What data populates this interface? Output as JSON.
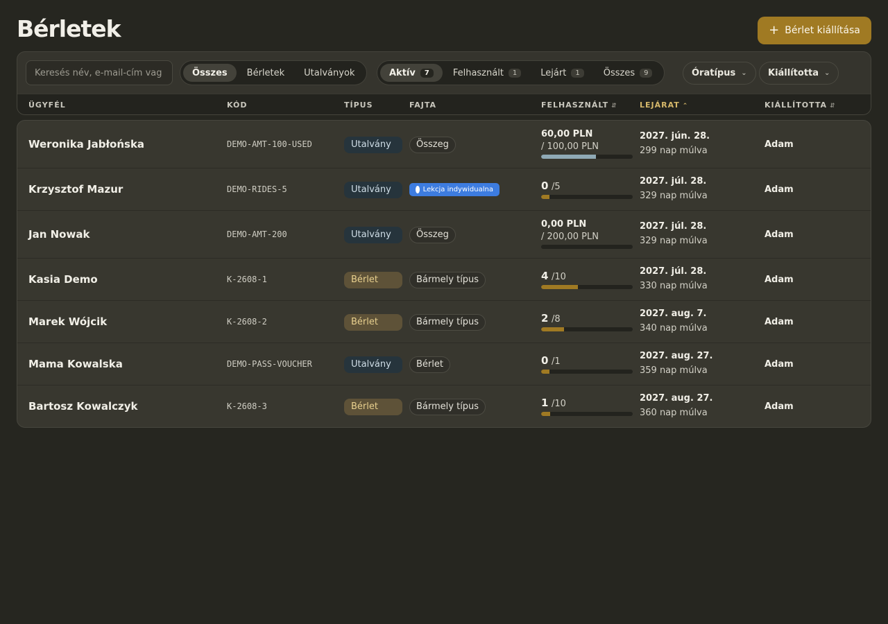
{
  "page": {
    "title": "Bérletek"
  },
  "actions": {
    "issue_label": "Bérlet kiállítása"
  },
  "search": {
    "placeholder": "Keresés név, e-mail-cím vag"
  },
  "type_filter": [
    "Összes",
    "Bérletek",
    "Utalványok"
  ],
  "status_filter": [
    {
      "label": "Aktív",
      "count": "7"
    },
    {
      "label": "Felhasznált",
      "count": "1"
    },
    {
      "label": "Lejárt",
      "count": "1"
    },
    {
      "label": "Összes",
      "count": "9"
    }
  ],
  "dropdowns": {
    "class_type": "Óratípus",
    "issued_by": "Kiállította"
  },
  "columns": {
    "customer": "ÜGYFÉL",
    "code": "KÓD",
    "type": "TÍPUS",
    "kind": "FAJTA",
    "used": "FELHASZNÁLT",
    "expiry": "LEJÁRAT",
    "issued_by": "KIÁLLÍTOTTA"
  },
  "colors": {
    "accent": "#a07a23",
    "voucher_bar": "#8fa9b5",
    "lesson_badge": "#3d7ce0"
  },
  "rows": [
    {
      "name": "Weronika Jabłońska",
      "code": "DEMO-AMT-100-USED",
      "type": "Utalvány",
      "kind": "Összeg",
      "usage_mode": "amount",
      "used_main": "60,00 PLN",
      "used_sub": "/ 100,00 PLN",
      "progress": 0.6,
      "expiry": "2027. jún. 28.",
      "expiry_rel": "299 nap múlva",
      "issuer": "Adam"
    },
    {
      "name": "Krzysztof Mazur",
      "code": "DEMO-RIDES-5",
      "type": "Utalvány",
      "kind": "Lekcja indywidualna",
      "usage_mode": "count",
      "used_main": "0",
      "used_sub": "/5",
      "progress": 0,
      "expiry": "2027. júl. 28.",
      "expiry_rel": "329 nap múlva",
      "issuer": "Adam"
    },
    {
      "name": "Jan Nowak",
      "code": "DEMO-AMT-200",
      "type": "Utalvány",
      "kind": "Összeg",
      "usage_mode": "amount",
      "used_main": "0,00 PLN",
      "used_sub": "/ 200,00 PLN",
      "progress": 0,
      "expiry": "2027. júl. 28.",
      "expiry_rel": "329 nap múlva",
      "issuer": "Adam"
    },
    {
      "name": "Kasia Demo",
      "code": "K-2608-1",
      "type": "Bérlet",
      "kind": "Bármely típus",
      "usage_mode": "count",
      "used_main": "4",
      "used_sub": "/10",
      "progress": 0.4,
      "expiry": "2027. júl. 28.",
      "expiry_rel": "330 nap múlva",
      "issuer": "Adam"
    },
    {
      "name": "Marek Wójcik",
      "code": "K-2608-2",
      "type": "Bérlet",
      "kind": "Bármely típus",
      "usage_mode": "count",
      "used_main": "2",
      "used_sub": "/8",
      "progress": 0.25,
      "expiry": "2027. aug. 7.",
      "expiry_rel": "340 nap múlva",
      "issuer": "Adam"
    },
    {
      "name": "Mama Kowalska",
      "code": "DEMO-PASS-VOUCHER",
      "type": "Utalvány",
      "kind": "Bérlet",
      "usage_mode": "count",
      "used_main": "0",
      "used_sub": "/1",
      "progress": 0,
      "expiry": "2027. aug. 27.",
      "expiry_rel": "359 nap múlva",
      "issuer": "Adam"
    },
    {
      "name": "Bartosz Kowalczyk",
      "code": "K-2608-3",
      "type": "Bérlet",
      "kind": "Bármely típus",
      "usage_mode": "count",
      "used_main": "1",
      "used_sub": "/10",
      "progress": 0.1,
      "expiry": "2027. aug. 27.",
      "expiry_rel": "360 nap múlva",
      "issuer": "Adam"
    }
  ]
}
